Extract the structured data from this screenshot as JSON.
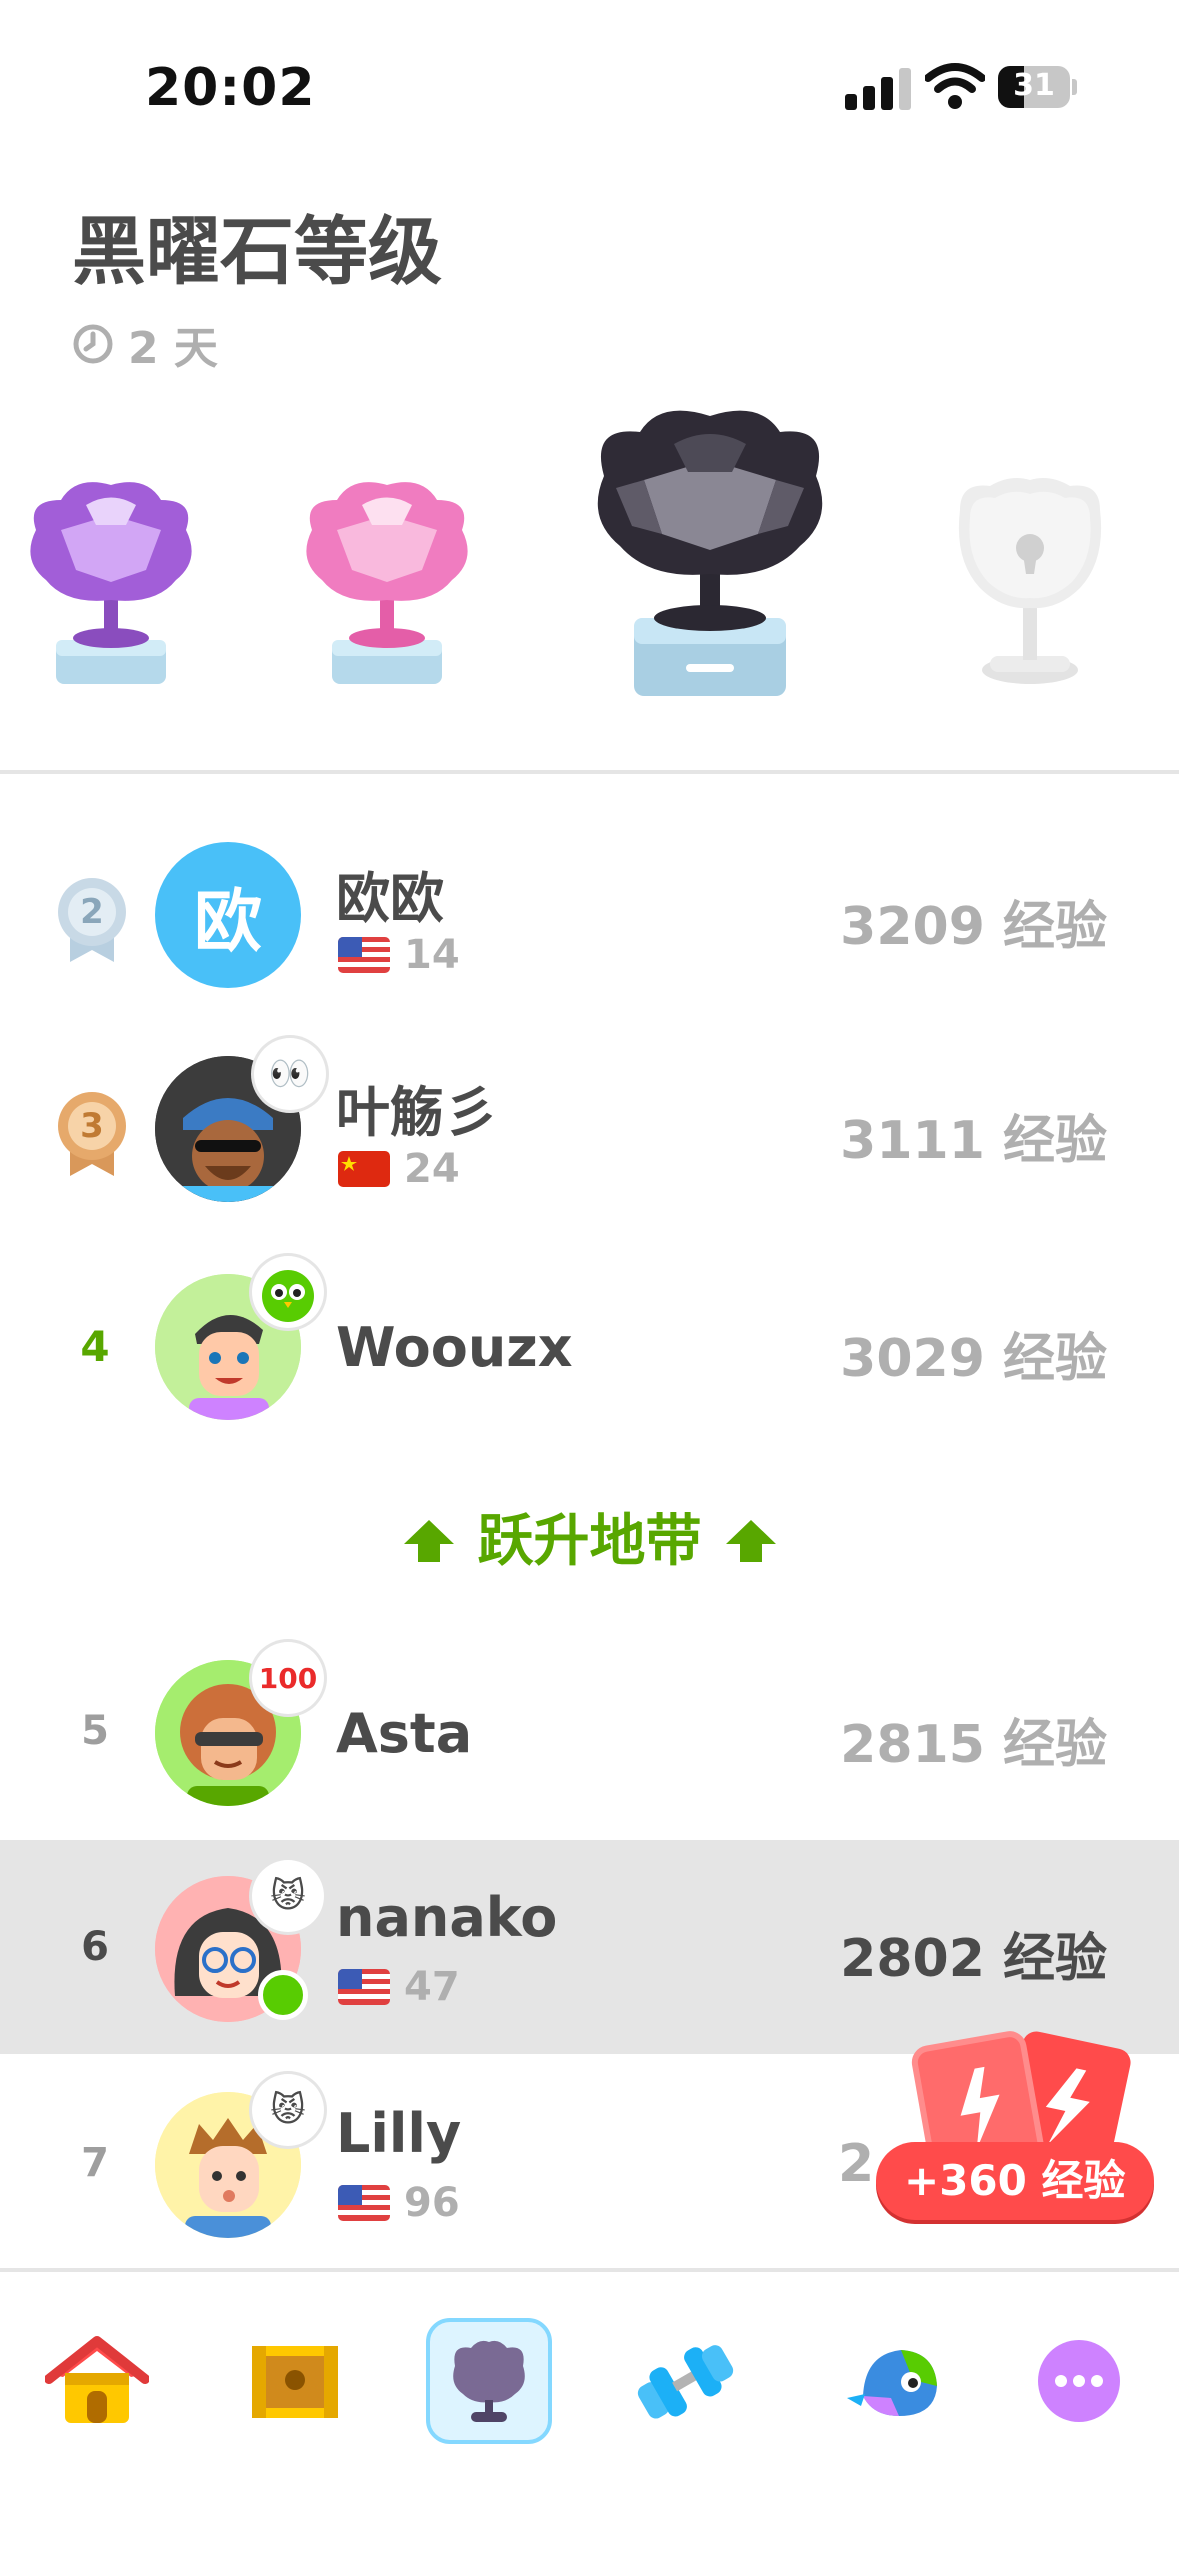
{
  "status_bar": {
    "time": "20:02",
    "battery": "31"
  },
  "header": {
    "title": "黑曜石等级",
    "time_left": "2 天"
  },
  "leaderboard": [
    {
      "rank": "2",
      "name": "欧欧",
      "avatar_text": "欧",
      "flag": "us",
      "streak": "14",
      "xp": "3209 经验"
    },
    {
      "rank": "3",
      "name": "叶觞彡",
      "flag": "cn",
      "streak": "24",
      "xp": "3111 经验"
    },
    {
      "rank": "4",
      "name": "Woouzx",
      "xp": "3029 经验"
    },
    {
      "rank": "5",
      "name": "Asta",
      "badge_text": "100",
      "xp": "2815 经验"
    },
    {
      "rank": "6",
      "name": "nanako",
      "flag": "us",
      "streak": "47",
      "xp": "2802 经验",
      "is_me": true
    },
    {
      "rank": "7",
      "name": "Lilly",
      "flag": "us",
      "streak": "96",
      "xp": "2..."
    }
  ],
  "promotion_zone": {
    "label": "跃升地带"
  },
  "xp_boost": {
    "label": "+360 经验"
  },
  "nav": {
    "items": [
      "home-icon",
      "chest-icon",
      "leagues-icon",
      "practice-icon",
      "characters-icon",
      "more-icon"
    ],
    "active": "leagues-icon"
  },
  "colors": {
    "green": "#58a700",
    "highlight_row": "#e5e5e5",
    "blue_avatar": "#49c0f8",
    "red": "#ff4b4b"
  }
}
